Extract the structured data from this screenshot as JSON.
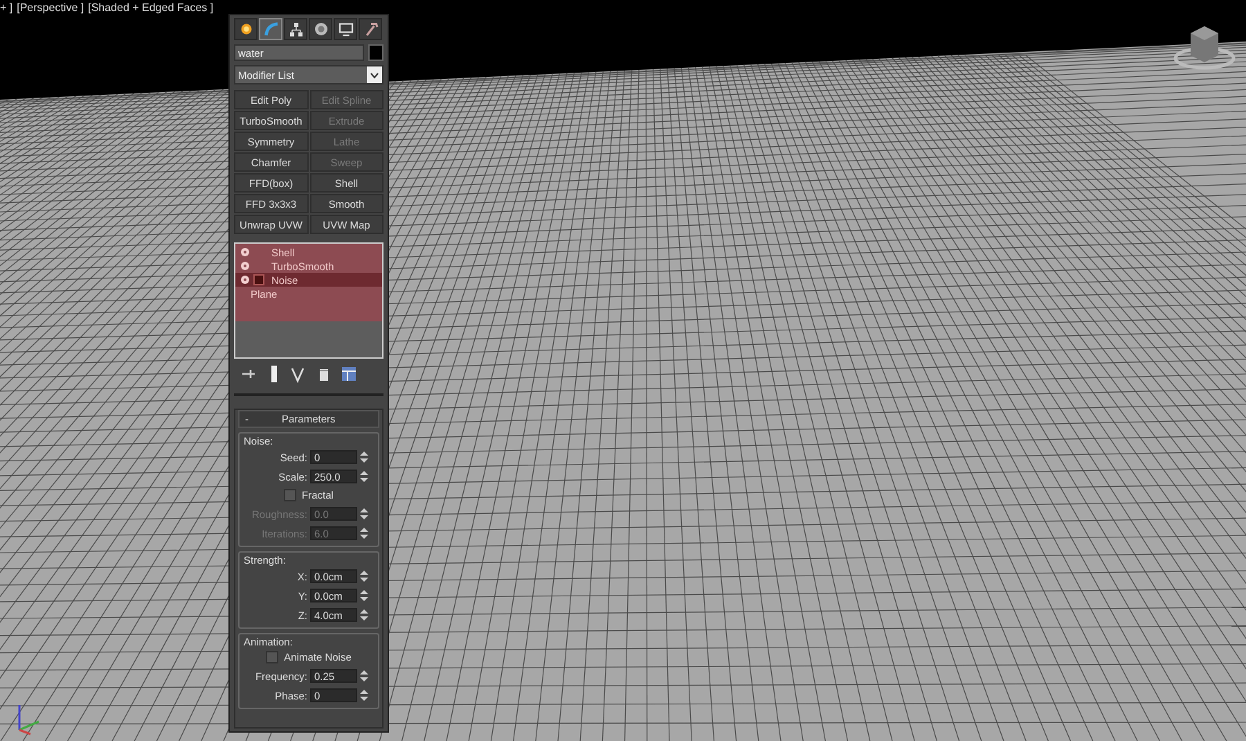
{
  "viewport": {
    "labels": [
      "+ ]",
      "[Perspective ]",
      "[Shaded + Edged Faces ]"
    ]
  },
  "command_panel": {
    "tabs": [
      {
        "kind": "create",
        "selected": false
      },
      {
        "kind": "modify",
        "selected": true
      },
      {
        "kind": "hierarchy",
        "selected": false
      },
      {
        "kind": "motion",
        "selected": false
      },
      {
        "kind": "display",
        "selected": false
      },
      {
        "kind": "utilities",
        "selected": false
      }
    ],
    "object_name": "water",
    "modifier_list": "Modifier List",
    "modifier_buttons": [
      {
        "label": "Edit Poly",
        "disabled": false
      },
      {
        "label": "Edit Spline",
        "disabled": true
      },
      {
        "label": "TurboSmooth",
        "disabled": false
      },
      {
        "label": "Extrude",
        "disabled": true
      },
      {
        "label": "Symmetry",
        "disabled": false
      },
      {
        "label": "Lathe",
        "disabled": true
      },
      {
        "label": "Chamfer",
        "disabled": false
      },
      {
        "label": "Sweep",
        "disabled": true
      },
      {
        "label": "FFD(box)",
        "disabled": false
      },
      {
        "label": "Shell",
        "disabled": false
      },
      {
        "label": "FFD 3x3x3",
        "disabled": false
      },
      {
        "label": "Smooth",
        "disabled": false
      },
      {
        "label": "Unwrap UVW",
        "disabled": false
      },
      {
        "label": "UVW Map",
        "disabled": false
      }
    ],
    "stack": [
      {
        "kind": "modifier",
        "label": "Shell",
        "on": true,
        "selected": false
      },
      {
        "kind": "modifier",
        "label": "TurboSmooth",
        "on": true,
        "selected": false
      },
      {
        "kind": "modifier",
        "label": "Noise",
        "on": true,
        "selected": true,
        "expandable": true
      },
      {
        "kind": "base",
        "label": "Plane",
        "selected": false
      }
    ],
    "stack_tools": [
      {
        "kind": "pin"
      },
      {
        "kind": "end-result"
      },
      {
        "kind": "make-unique"
      },
      {
        "kind": "remove"
      },
      {
        "kind": "configure"
      }
    ],
    "rollout": {
      "collapse": "-",
      "title": "Parameters",
      "groups": [
        {
          "title": "Noise:",
          "rows": [
            {
              "kind": "spinner",
              "label": "Seed:",
              "value": "0",
              "disabled": false
            },
            {
              "kind": "spinner",
              "label": "Scale:",
              "value": "250.0",
              "disabled": false
            },
            {
              "kind": "checkbox",
              "label": "Fractal",
              "checked": false
            },
            {
              "kind": "spinner",
              "label": "Roughness:",
              "value": "0.0",
              "disabled": true
            },
            {
              "kind": "spinner",
              "label": "Iterations:",
              "value": "6.0",
              "disabled": true
            }
          ]
        },
        {
          "title": "Strength:",
          "rows": [
            {
              "kind": "spinner",
              "label": "X:",
              "value": "0.0cm",
              "disabled": false
            },
            {
              "kind": "spinner",
              "label": "Y:",
              "value": "0.0cm",
              "disabled": false
            },
            {
              "kind": "spinner",
              "label": "Z:",
              "value": "4.0cm",
              "disabled": false
            }
          ]
        },
        {
          "title": "Animation:",
          "rows": [
            {
              "kind": "checkbox",
              "label": "Animate Noise",
              "checked": false
            },
            {
              "kind": "spinner",
              "label": "Frequency:",
              "value": "0.25",
              "disabled": false
            },
            {
              "kind": "spinner",
              "label": "Phase:",
              "value": "0",
              "disabled": false
            }
          ]
        }
      ]
    }
  }
}
